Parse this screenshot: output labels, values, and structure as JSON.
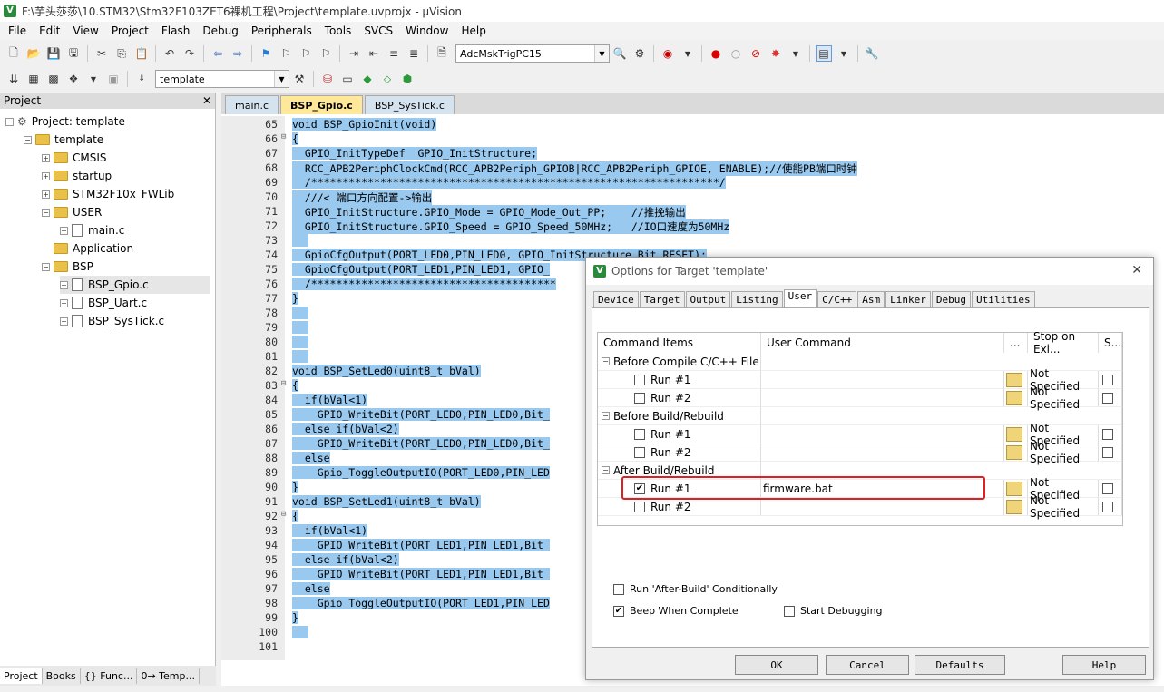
{
  "window": {
    "title": "F:\\芋头莎莎\\10.STM32\\Stm32F103ZET6裸机工程\\Project\\template.uvprojx - µVision",
    "app_icon": "V"
  },
  "menu": [
    "File",
    "Edit",
    "View",
    "Project",
    "Flash",
    "Debug",
    "Peripherals",
    "Tools",
    "SVCS",
    "Window",
    "Help"
  ],
  "toolbar1": {
    "target_combo": "AdcMskTrigPC15"
  },
  "toolbar2": {
    "target_combo": "template"
  },
  "project_panel": {
    "header": "Project",
    "close": "✕",
    "tree": [
      {
        "label": "Project: template",
        "indent": 0,
        "pm": "-",
        "icon": "proj"
      },
      {
        "label": "template",
        "indent": 1,
        "pm": "-",
        "icon": "folder"
      },
      {
        "label": "CMSIS",
        "indent": 2,
        "pm": "+",
        "icon": "folder"
      },
      {
        "label": "startup",
        "indent": 2,
        "pm": "+",
        "icon": "folder"
      },
      {
        "label": "STM32F10x_FWLib",
        "indent": 2,
        "pm": "+",
        "icon": "folder"
      },
      {
        "label": "USER",
        "indent": 2,
        "pm": "-",
        "icon": "folder"
      },
      {
        "label": "main.c",
        "indent": 3,
        "pm": "+",
        "icon": "file"
      },
      {
        "label": "Application",
        "indent": 2,
        "pm": "",
        "icon": "folder"
      },
      {
        "label": "BSP",
        "indent": 2,
        "pm": "-",
        "icon": "folder"
      },
      {
        "label": "BSP_Gpio.c",
        "indent": 3,
        "pm": "+",
        "icon": "file"
      },
      {
        "label": "BSP_Uart.c",
        "indent": 3,
        "pm": "+",
        "icon": "file"
      },
      {
        "label": "BSP_SysTick.c",
        "indent": 3,
        "pm": "+",
        "icon": "file"
      }
    ],
    "tabs": [
      "Project",
      "Books",
      "{} Func...",
      "0→ Temp..."
    ]
  },
  "editor": {
    "tabs": [
      {
        "label": "main.c",
        "active": false
      },
      {
        "label": "BSP_Gpio.c",
        "active": true
      },
      {
        "label": "BSP_SysTick.c",
        "active": false
      }
    ],
    "lines": [
      {
        "n": "65",
        "f": "",
        "t": "void BSP_GpioInit(void)"
      },
      {
        "n": "66",
        "f": "⊟",
        "t": "{"
      },
      {
        "n": "67",
        "f": "",
        "t": "  GPIO_InitTypeDef  GPIO_InitStructure;"
      },
      {
        "n": "68",
        "f": "",
        "t": "  RCC_APB2PeriphClockCmd(RCC_APB2Periph_GPIOB|RCC_APB2Periph_GPIOE, ENABLE);//使能PB端口时钟"
      },
      {
        "n": "69",
        "f": "",
        "t": "  /*****************************************************************/"
      },
      {
        "n": "70",
        "f": "",
        "t": "  ///< 端口方向配置->输出"
      },
      {
        "n": "71",
        "f": "",
        "t": "  GPIO_InitStructure.GPIO_Mode = GPIO_Mode_Out_PP;    //推挽输出"
      },
      {
        "n": "72",
        "f": "",
        "t": "  GPIO_InitStructure.GPIO_Speed = GPIO_Speed_50MHz;   //IO口速度为50MHz"
      },
      {
        "n": "73",
        "f": "",
        "t": "   "
      },
      {
        "n": "74",
        "f": "",
        "t": "  GpioCfgOutput(PORT_LED0,PIN_LED0, GPIO_InitStructure.Bit_RESET);"
      },
      {
        "n": "75",
        "f": "",
        "t": "  GpioCfgOutput(PORT_LED1,PIN_LED1, GPIO_"
      },
      {
        "n": "76",
        "f": "",
        "t": "  /***************************************"
      },
      {
        "n": "77",
        "f": "",
        "t": "}"
      },
      {
        "n": "78",
        "f": "",
        "t": "  "
      },
      {
        "n": "79",
        "f": "",
        "t": "  "
      },
      {
        "n": "80",
        "f": "",
        "t": "  "
      },
      {
        "n": "81",
        "f": "",
        "t": "  "
      },
      {
        "n": "82",
        "f": "",
        "t": "void BSP_SetLed0(uint8_t bVal)"
      },
      {
        "n": "83",
        "f": "⊟",
        "t": "{"
      },
      {
        "n": "84",
        "f": "",
        "t": "  if(bVal<1)"
      },
      {
        "n": "85",
        "f": "",
        "t": "    GPIO_WriteBit(PORT_LED0,PIN_LED0,Bit_"
      },
      {
        "n": "86",
        "f": "",
        "t": "  else if(bVal<2)"
      },
      {
        "n": "87",
        "f": "",
        "t": "    GPIO_WriteBit(PORT_LED0,PIN_LED0,Bit_"
      },
      {
        "n": "88",
        "f": "",
        "t": "  else"
      },
      {
        "n": "89",
        "f": "",
        "t": "    Gpio_ToggleOutputIO(PORT_LED0,PIN_LED"
      },
      {
        "n": "90",
        "f": "",
        "t": "}"
      },
      {
        "n": "91",
        "f": "",
        "t": "void BSP_SetLed1(uint8_t bVal)"
      },
      {
        "n": "92",
        "f": "⊟",
        "t": "{"
      },
      {
        "n": "93",
        "f": "",
        "t": "  if(bVal<1)"
      },
      {
        "n": "94",
        "f": "",
        "t": "    GPIO_WriteBit(PORT_LED1,PIN_LED1,Bit_"
      },
      {
        "n": "95",
        "f": "",
        "t": "  else if(bVal<2)"
      },
      {
        "n": "96",
        "f": "",
        "t": "    GPIO_WriteBit(PORT_LED1,PIN_LED1,Bit_"
      },
      {
        "n": "97",
        "f": "",
        "t": "  else"
      },
      {
        "n": "98",
        "f": "",
        "t": "    Gpio_ToggleOutputIO(PORT_LED1,PIN_LED"
      },
      {
        "n": "99",
        "f": "",
        "t": "}"
      },
      {
        "n": "100",
        "f": "",
        "t": "  "
      },
      {
        "n": "101",
        "f": "",
        "t": ""
      }
    ]
  },
  "dialog": {
    "title": "Options for Target 'template'",
    "close": "✕",
    "tabs": [
      "Device",
      "Target",
      "Output",
      "Listing",
      "User",
      "C/C++",
      "Asm",
      "Linker",
      "Debug",
      "Utilities"
    ],
    "active_tab": "User",
    "columns": [
      "Command Items",
      "User Command",
      "...",
      "Stop on Exi...",
      "S..."
    ],
    "rows": [
      {
        "kind": "group",
        "label": "Before Compile C/C++ File"
      },
      {
        "kind": "item",
        "label": "Run #1",
        "checked": false,
        "command": "",
        "stop": "Not Specified"
      },
      {
        "kind": "item",
        "label": "Run #2",
        "checked": false,
        "command": "",
        "stop": "Not Specified"
      },
      {
        "kind": "group",
        "label": "Before Build/Rebuild"
      },
      {
        "kind": "item",
        "label": "Run #1",
        "checked": false,
        "command": "",
        "stop": "Not Specified"
      },
      {
        "kind": "item",
        "label": "Run #2",
        "checked": false,
        "command": "",
        "stop": "Not Specified"
      },
      {
        "kind": "group",
        "label": "After Build/Rebuild"
      },
      {
        "kind": "item",
        "label": "Run #1",
        "checked": true,
        "command": "firmware.bat",
        "stop": "Not Specified"
      },
      {
        "kind": "item",
        "label": "Run #2",
        "checked": false,
        "command": "",
        "stop": "Not Specified"
      }
    ],
    "options": {
      "run_after_build": "Run 'After-Build' Conditionally",
      "beep": "Beep When Complete",
      "start_debug": "Start Debugging"
    },
    "buttons": {
      "ok": "OK",
      "cancel": "Cancel",
      "defaults": "Defaults",
      "help": "Help"
    }
  }
}
